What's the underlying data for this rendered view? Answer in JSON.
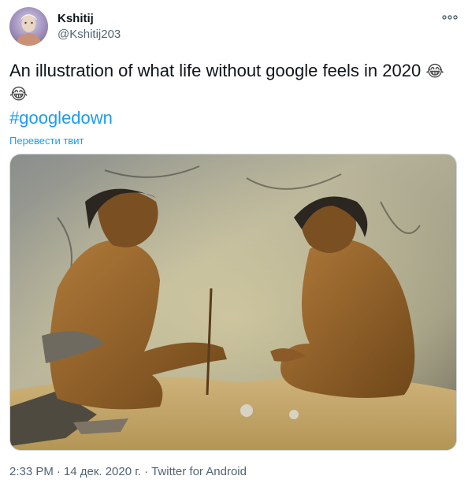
{
  "author": {
    "name": "Kshitij",
    "handle": "@Kshitij203"
  },
  "tweet": {
    "text": "An illustration of what life without google feels in 2020",
    "emoji_1": "😂",
    "emoji_2": "😂",
    "hashtag": "#googledown",
    "translate_label": "Перевести твит"
  },
  "meta": {
    "time": "2:33 PM",
    "separator": "·",
    "date": "14 дек. 2020 г.",
    "source": "Twitter for Android"
  },
  "colors": {
    "link": "#1d9bf0",
    "secondary_text": "#536471"
  },
  "icons": {
    "more": "more-horizontal-icon"
  }
}
